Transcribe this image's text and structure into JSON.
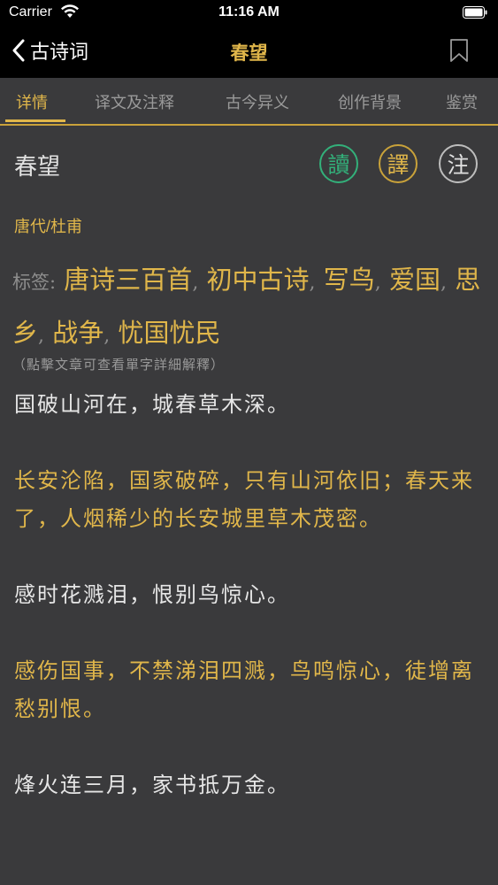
{
  "status": {
    "carrier": "Carrier",
    "time": "11:16 AM"
  },
  "nav": {
    "back_label": "古诗词",
    "title": "春望"
  },
  "tabs": [
    {
      "label": "详情"
    },
    {
      "label": "译文及注释"
    },
    {
      "label": "古今异义"
    },
    {
      "label": "创作背景"
    },
    {
      "label": "鉴赏"
    }
  ],
  "poem": {
    "title": "春望",
    "author": "唐代/杜甫",
    "buttons": {
      "read": "讀",
      "translate": "譯",
      "annotate": "注"
    },
    "tags_label": "标签:",
    "tags": [
      "唐诗三百首",
      "初中古诗",
      "写鸟",
      "爱国",
      "思乡",
      "战争",
      "忧国忧民"
    ],
    "tag_sep": ",",
    "hint": "（點擊文章可查看單字詳細解釋）",
    "lines": [
      {
        "original": "国破山河在，城春草木深。",
        "translation": "长安沦陷，国家破碎，只有山河依旧；春天来了，人烟稀少的长安城里草木茂密。"
      },
      {
        "original": "感时花溅泪，恨别鸟惊心。",
        "translation": "感伤国事，不禁涕泪四溅，鸟鸣惊心，徒增离愁别恨。"
      },
      {
        "original": "烽火连三月，家书抵万金。",
        "translation": ""
      }
    ]
  },
  "colors": {
    "accent": "#e0b64a",
    "green": "#33b07a",
    "background": "#3a3a3c"
  }
}
